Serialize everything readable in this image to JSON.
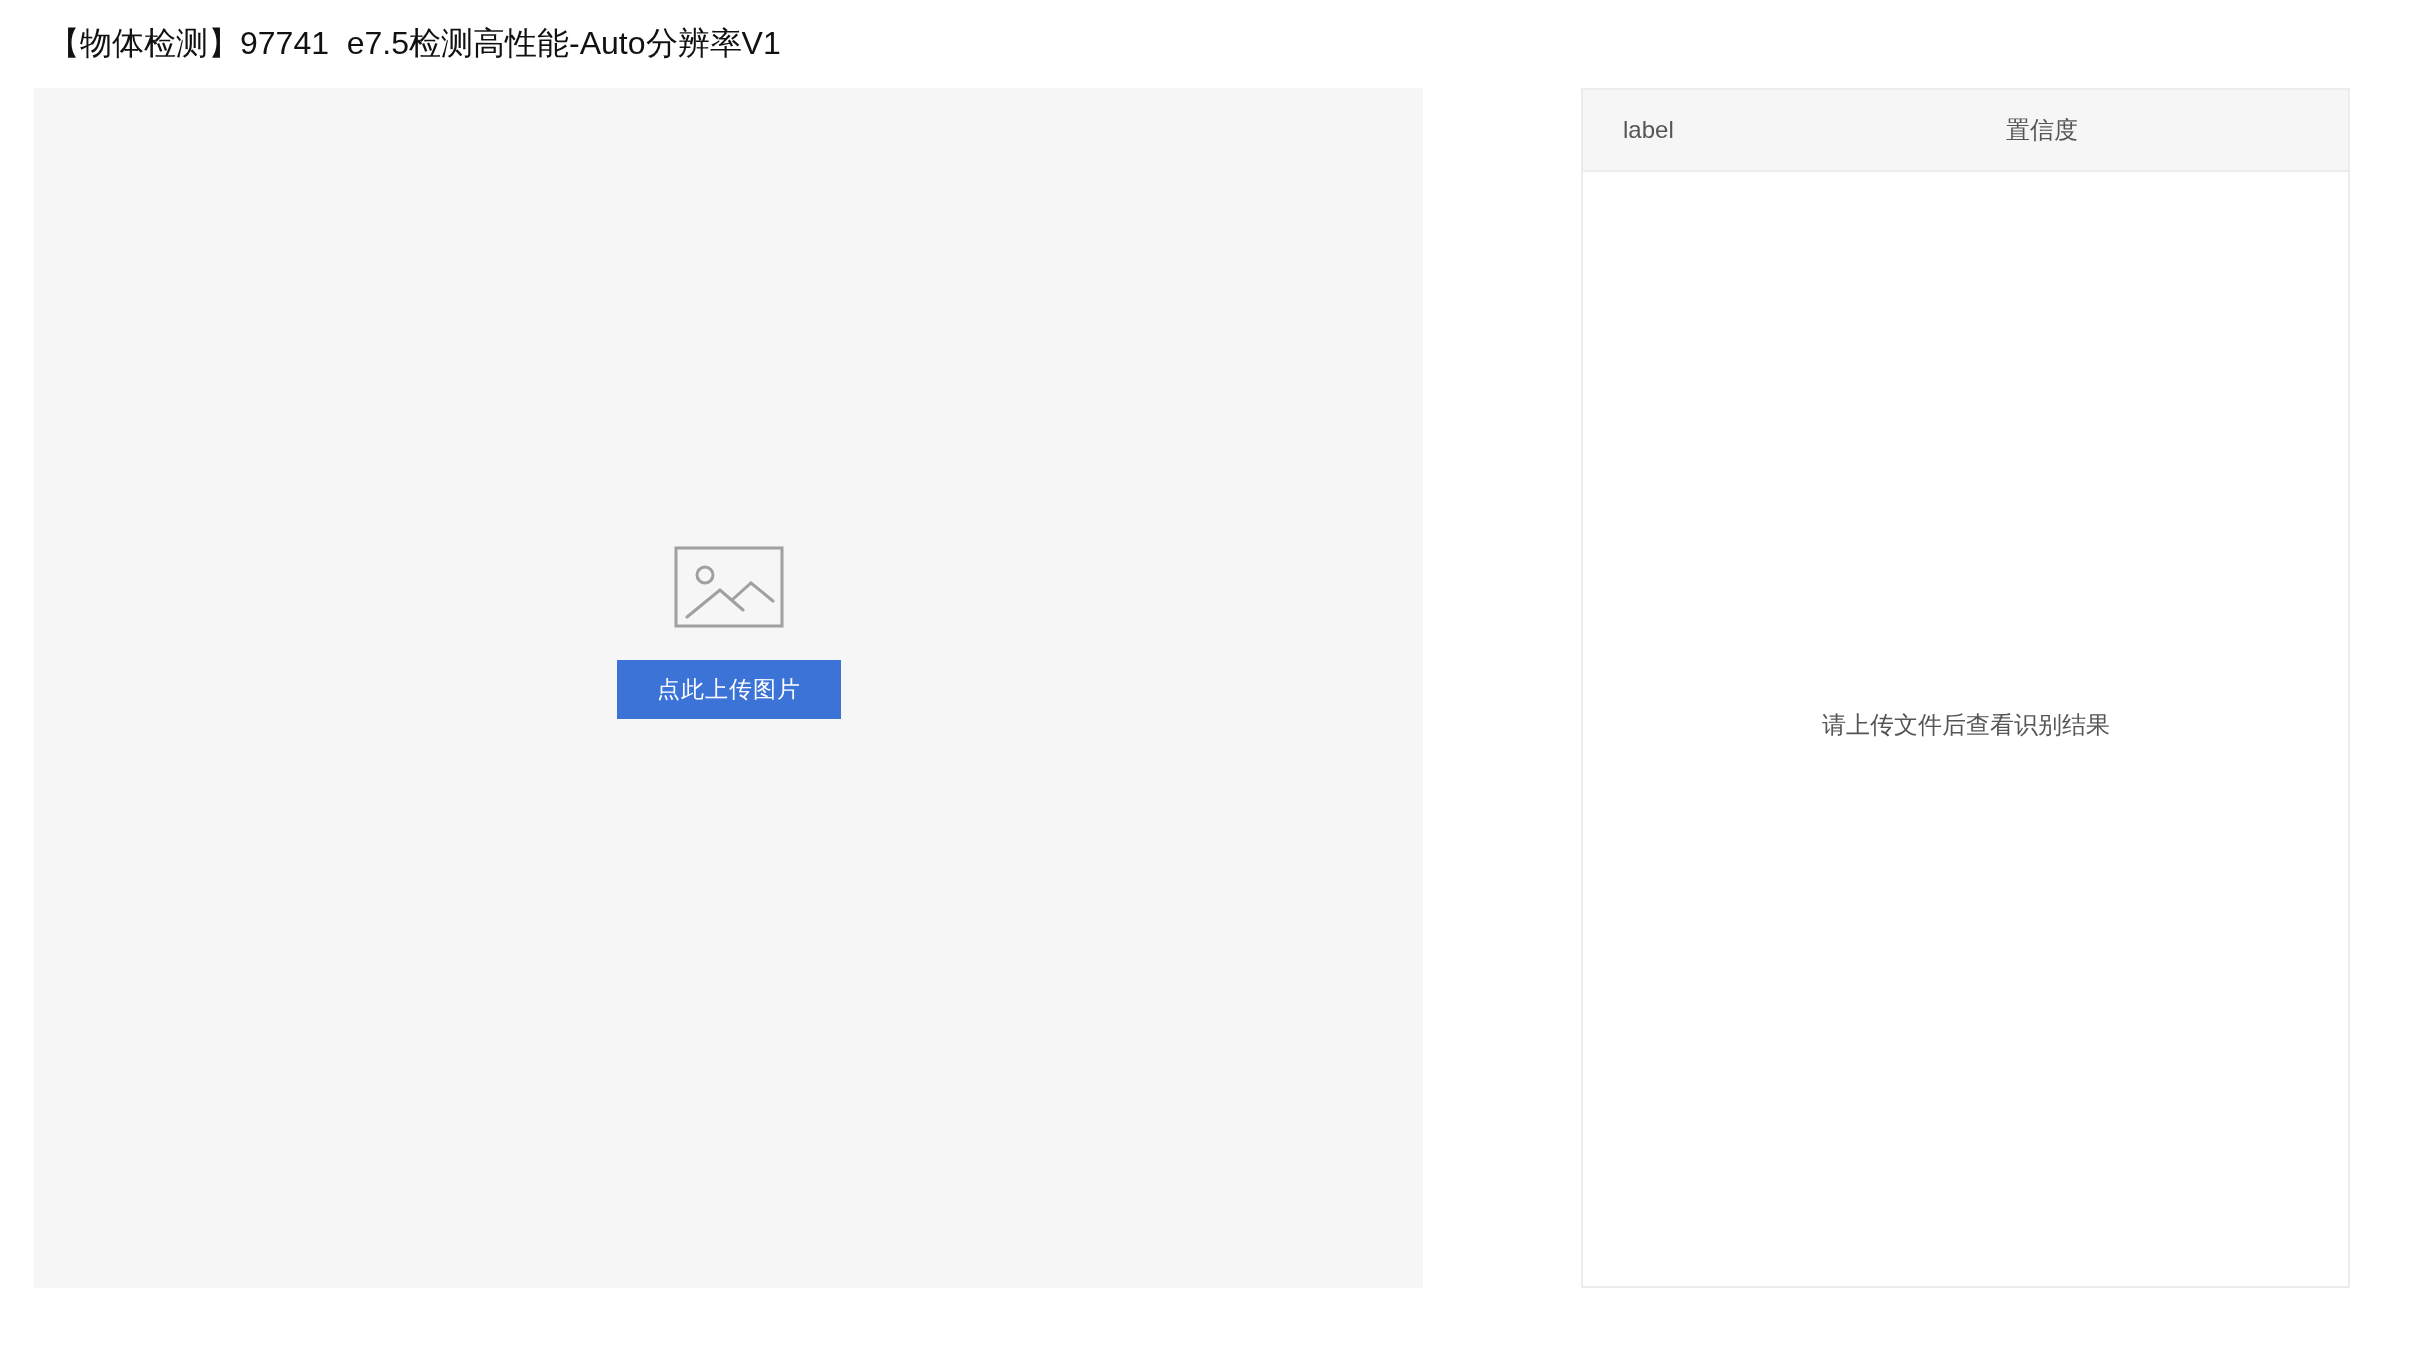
{
  "title": "【物体检测】97741  e7.5检测高性能-Auto分辨率V1",
  "upload": {
    "button": "点此上传图片"
  },
  "results": {
    "columns": [
      "label",
      "置信度"
    ],
    "empty_text": "请上传文件后查看识别结果"
  }
}
